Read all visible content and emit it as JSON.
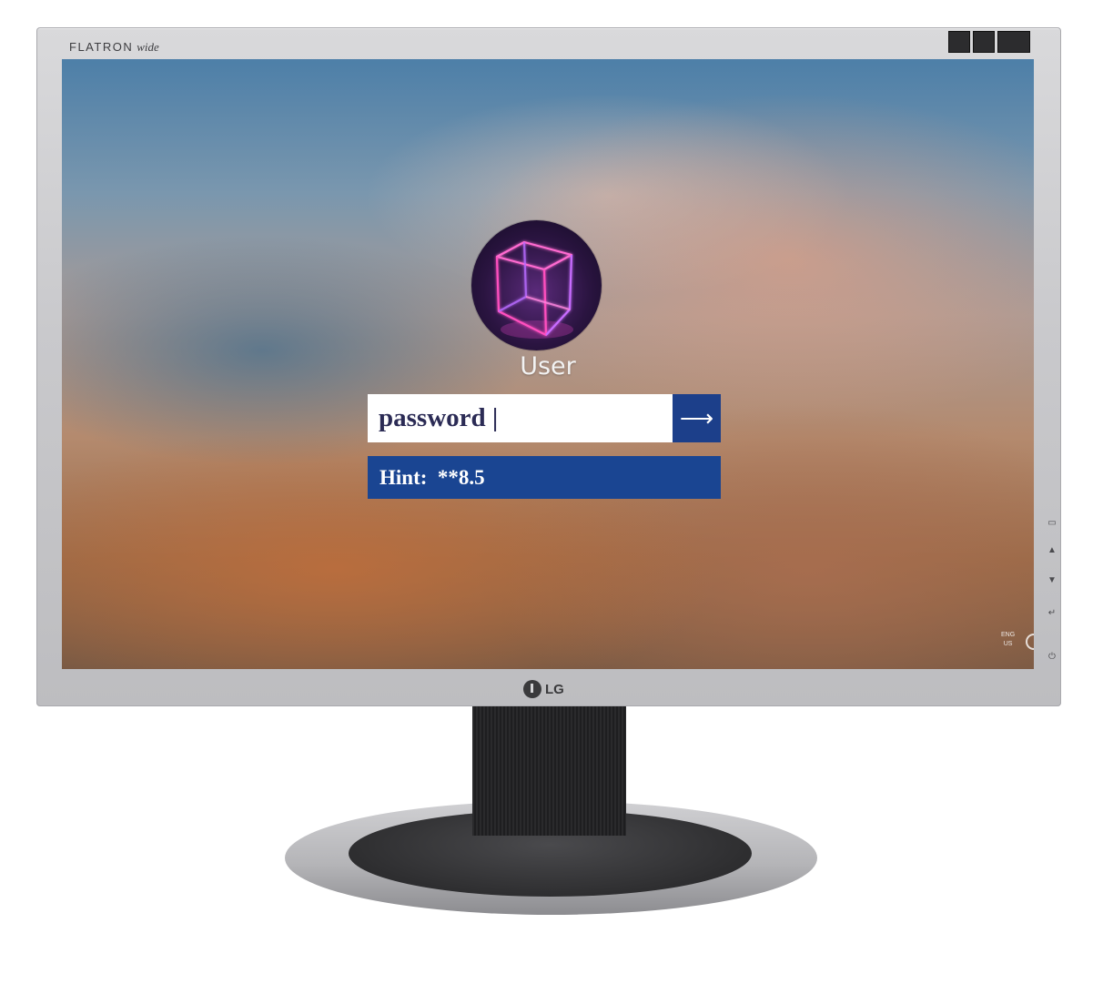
{
  "monitor": {
    "brand": "FLATRON",
    "brand_suffix": "wide",
    "logo_text": "LG"
  },
  "login": {
    "username": "User",
    "password_value": "password |",
    "submit_icon": "arrow-right-icon",
    "submit_glyph": "⟶",
    "hint_label": "Hint:",
    "hint_value": "**8.5"
  },
  "tray": {
    "language_line1": "ENG",
    "language_line2": "US"
  },
  "colors": {
    "submit_bg": "#1c3f8a",
    "hint_bg": "#1a4592",
    "password_text": "#2b2b55"
  }
}
